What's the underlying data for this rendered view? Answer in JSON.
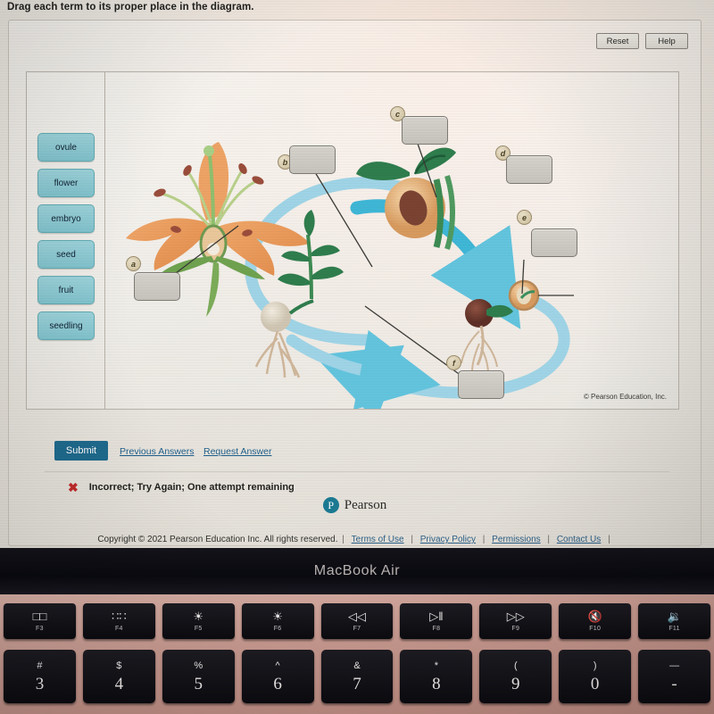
{
  "instruction": "Drag each term to its proper place in the diagram.",
  "toolbar": {
    "reset_label": "Reset",
    "help_label": "Help"
  },
  "term_bank": {
    "terms": [
      {
        "label": "ovule"
      },
      {
        "label": "flower"
      },
      {
        "label": "embryo"
      },
      {
        "label": "seed"
      },
      {
        "label": "fruit"
      },
      {
        "label": "seedling"
      }
    ]
  },
  "diagram": {
    "credit": "© Pearson Education, Inc.",
    "drop_targets": [
      {
        "marker": "a",
        "value": ""
      },
      {
        "marker": "b",
        "value": ""
      },
      {
        "marker": "c",
        "value": ""
      },
      {
        "marker": "d",
        "value": ""
      },
      {
        "marker": "e",
        "value": ""
      },
      {
        "marker": "f",
        "value": ""
      }
    ]
  },
  "actions": {
    "submit_label": "Submit",
    "previous_answers_label": "Previous Answers",
    "request_answer_label": "Request Answer"
  },
  "feedback": {
    "icon": "x-mark",
    "message": "Incorrect; Try Again; One attempt remaining"
  },
  "brand": {
    "logo_letter": "P",
    "name": "Pearson"
  },
  "footer": {
    "copyright": "Copyright © 2021 Pearson Education Inc. All rights reserved.",
    "links": [
      "Terms of Use",
      "Privacy Policy",
      "Permissions",
      "Contact Us"
    ],
    "separator": "|"
  },
  "device": {
    "model": "MacBook Air",
    "function_keys": [
      {
        "glyph": "□□",
        "label": "F3"
      },
      {
        "glyph": "∷∷",
        "label": "F4"
      },
      {
        "glyph": "☀",
        "label": "F5"
      },
      {
        "glyph": "☀",
        "label": "F6"
      },
      {
        "glyph": "◁◁",
        "label": "F7"
      },
      {
        "glyph": "▷‖",
        "label": "F8"
      },
      {
        "glyph": "▷▷",
        "label": "F9"
      },
      {
        "glyph": "🔇",
        "label": "F10"
      },
      {
        "glyph": "🔉",
        "label": "F11"
      }
    ],
    "number_keys": [
      {
        "shift": "#",
        "base": "3"
      },
      {
        "shift": "$",
        "base": "4"
      },
      {
        "shift": "%",
        "base": "5"
      },
      {
        "shift": "^",
        "base": "6"
      },
      {
        "shift": "&",
        "base": "7"
      },
      {
        "shift": "*",
        "base": "8"
      },
      {
        "shift": "(",
        "base": "9"
      },
      {
        "shift": ")",
        "base": "0"
      },
      {
        "shift": "—",
        "base": "-"
      }
    ]
  },
  "colors": {
    "chip": "#8fccd6",
    "submit": "#1f6b8e",
    "link": "#1f5f8b",
    "error": "#c22b2b",
    "arrow": "#63c4dd"
  }
}
